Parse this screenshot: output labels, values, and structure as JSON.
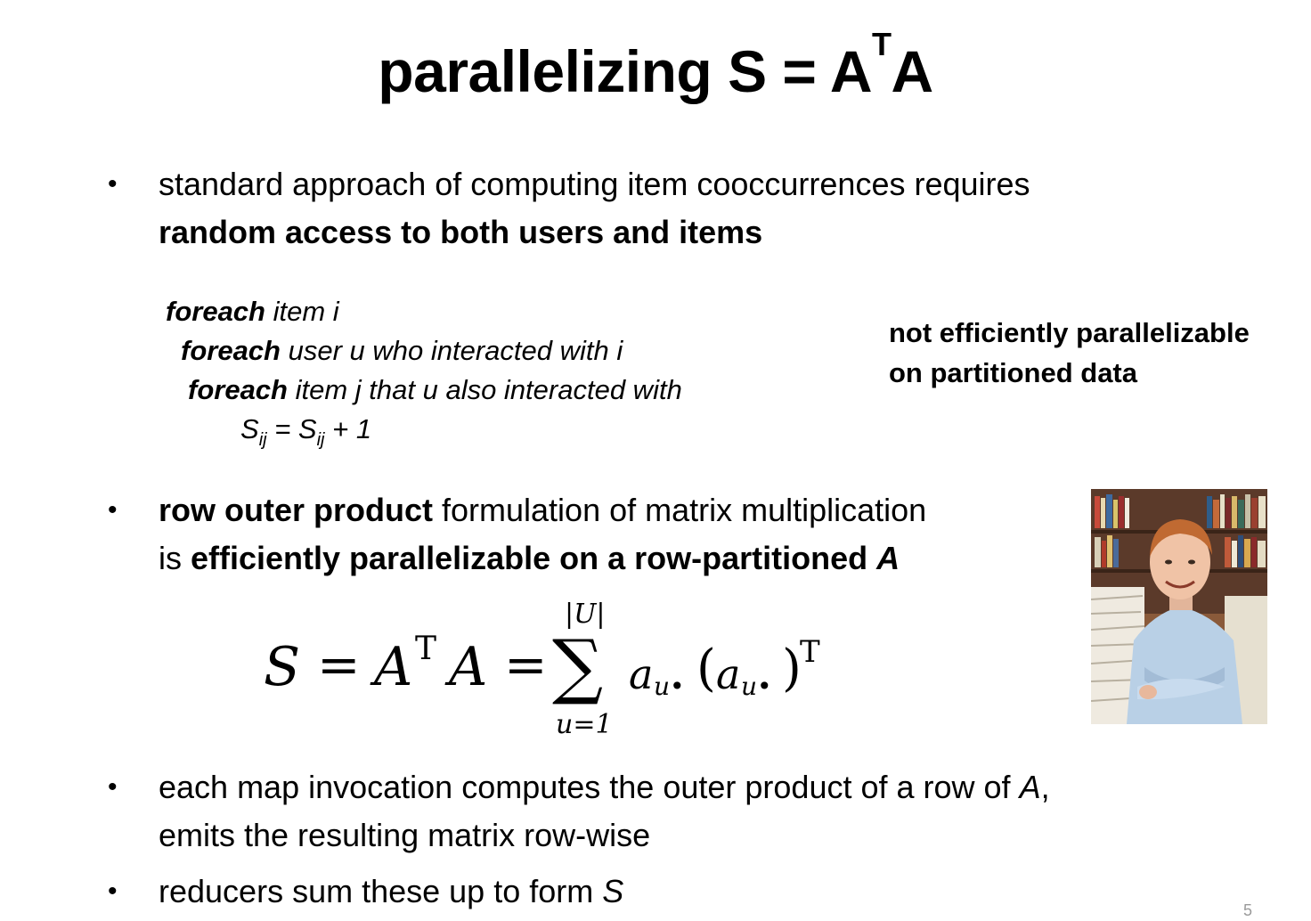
{
  "title": {
    "main": "parallelizing S = A",
    "sup": "T",
    "tail": "A"
  },
  "bullets": {
    "one": {
      "line1": "standard approach of computing item cooccurrences requires",
      "line2_bold": "random access to both users and items"
    },
    "two": {
      "line1_bold": "row outer product",
      "line1_rest": " formulation of matrix multiplication",
      "line2_pre": "is ",
      "line2_bold": "efficiently parallelizable on a row-partitioned ",
      "line2_bold_italic": "A"
    },
    "three": {
      "line1_pre": "each map invocation computes the outer product of a row of ",
      "line1_italic": "A",
      "line1_post": ",",
      "line2": "emits the resulting matrix row-wise"
    },
    "four": {
      "text": "reducers sum these up to form ",
      "italic": "S"
    }
  },
  "pseudocode": {
    "line1": {
      "kw": "foreach",
      "rest": " item i"
    },
    "line2": {
      "kw": "foreach",
      "rest": " user u who interacted with i"
    },
    "line3": {
      "kw": "foreach",
      "rest": " item j that u also interacted with"
    },
    "line4": {
      "s1": "S",
      "sub1": "ij",
      "eq": " = ",
      "s2": "S",
      "sub2": "ij",
      "tail": " + 1"
    }
  },
  "side_note": {
    "line1": "not efficiently parallelizable",
    "line2": "on partitioned data"
  },
  "formula": {
    "S": "S",
    "eq1": "=",
    "A1": "A",
    "T1": "T",
    "A2": "A",
    "eq2": "=",
    "upper": "|U|",
    "sigma": "∑",
    "lower": "u=1",
    "a1": "a",
    "sub_a1": "u•",
    "lparen": "(",
    "a2": "a",
    "sub_a2": "u•",
    "rparen": ")",
    "T2": "T"
  },
  "page_number": "5"
}
